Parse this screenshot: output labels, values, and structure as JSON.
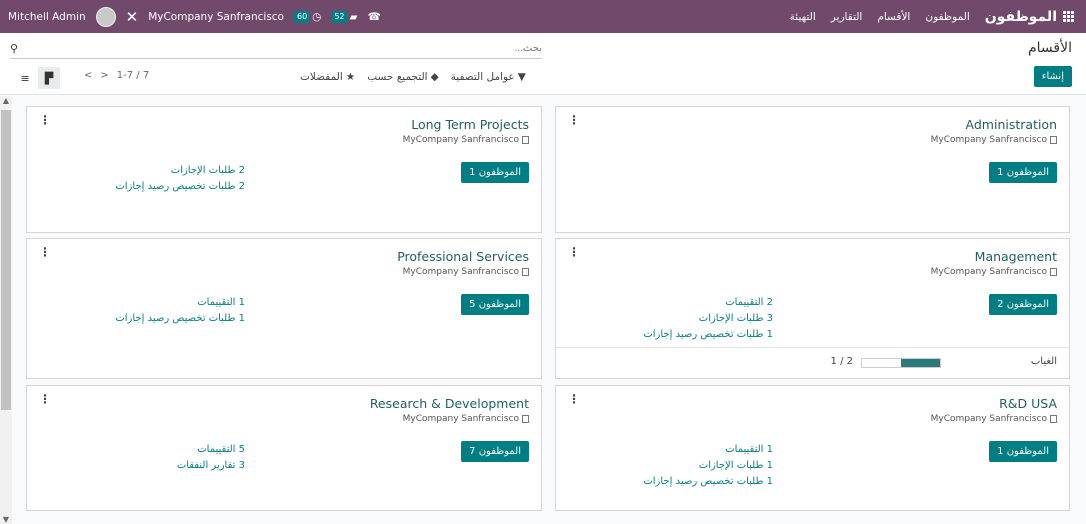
{
  "topbar": {
    "brand": "الموظفون",
    "menu": [
      "الموظفون",
      "الأقسام",
      "التقارير",
      "التهيئة"
    ],
    "user_name": "Mitchell Admin",
    "company": "MyCompany Sanfrancisco",
    "activity_count": "60",
    "message_count": "52"
  },
  "control": {
    "breadcrumb": "الأقسام",
    "create_label": "إنشاء",
    "search_placeholder": "بحث...",
    "filters_label": "عوامل التصفية",
    "groupby_label": "التجميع حسب",
    "favorites_label": "المفضلات",
    "pager": "1-7 / 7"
  },
  "cards": [
    {
      "title": "Administration",
      "company": "MyCompany Sanfrancisco",
      "employees": "1 الموظفون",
      "stats": []
    },
    {
      "title": "Long Term Projects",
      "company": "MyCompany Sanfrancisco",
      "employees": "1 الموظفون",
      "stats": [
        "2 طلبات الإجازات",
        "2 طلبات تخصيص رصيد إجازات"
      ]
    },
    {
      "title": "Management",
      "company": "MyCompany Sanfrancisco",
      "employees": "2 الموظفون",
      "stats": [
        "2 التقييمات",
        "3 طلبات الإجازات",
        "1 طلبات تخصيص رصيد إجازات"
      ],
      "absence_label": "الغياب",
      "absence_fraction": "1 / 2",
      "absence_progress": 0.5
    },
    {
      "title": "Professional Services",
      "company": "MyCompany Sanfrancisco",
      "employees": "5 الموظفون",
      "stats": [
        "1 التقييمات",
        "1 طلبات تخصيص رصيد إجازات"
      ]
    },
    {
      "title": "R&D USA",
      "company": "MyCompany Sanfrancisco",
      "employees": "1 الموظفون",
      "stats": [
        "1 التقييمات",
        "1 طلبات الإجازات",
        "1 طلبات تخصيص رصيد إجازات"
      ]
    },
    {
      "title": "Research & Development",
      "company": "MyCompany Sanfrancisco",
      "employees": "7 الموظفون",
      "stats": [
        "5 التقييمات",
        "3 تقارير النفقات"
      ]
    }
  ]
}
